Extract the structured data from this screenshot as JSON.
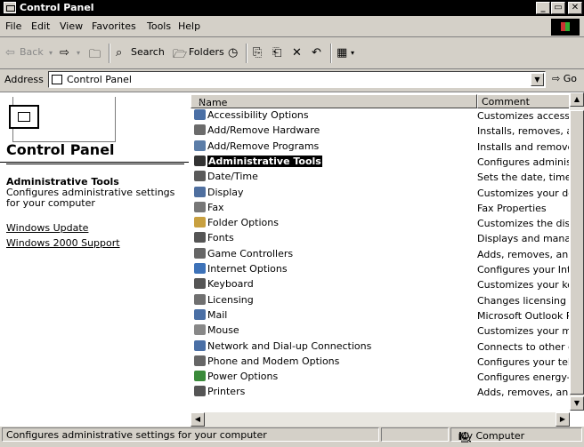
{
  "window": {
    "title": "Control Panel"
  },
  "title_buttons": {
    "minimize": "_",
    "maximize": "▭",
    "close": "✕"
  },
  "menu": [
    "File",
    "Edit",
    "View",
    "Favorites",
    "Tools",
    "Help"
  ],
  "toolbar": {
    "back": "Back",
    "search": "Search",
    "folders": "Folders"
  },
  "address": {
    "label": "Address",
    "value": "Control Panel",
    "go": "Go"
  },
  "left_pane": {
    "title": "Control Panel",
    "selected_title": "Administrative Tools",
    "selected_desc": "Configures administrative settings for your computer",
    "links": [
      "Windows Update",
      "Windows 2000 Support"
    ]
  },
  "columns": {
    "name": "Name",
    "comment": "Comment"
  },
  "items": [
    {
      "name": "Accessibility Options",
      "comment": "Customizes accessi...",
      "icon": "accessibility-icon",
      "color": "#4a6fa5"
    },
    {
      "name": "Add/Remove Hardware",
      "comment": "Installs, removes, a...",
      "icon": "hardware-icon",
      "color": "#6b6b6b"
    },
    {
      "name": "Add/Remove Programs",
      "comment": "Installs and remove...",
      "icon": "programs-icon",
      "color": "#5b7da8"
    },
    {
      "name": "Administrative Tools",
      "comment": "Configures administ...",
      "icon": "admin-tools-icon",
      "color": "#333333",
      "selected": true
    },
    {
      "name": "Date/Time",
      "comment": "Sets the date, time,...",
      "icon": "clock-icon",
      "color": "#5a5a5a"
    },
    {
      "name": "Display",
      "comment": "Customizes your de...",
      "icon": "display-icon",
      "color": "#4f6f9f"
    },
    {
      "name": "Fax",
      "comment": "Fax Properties",
      "icon": "fax-icon",
      "color": "#777777"
    },
    {
      "name": "Folder Options",
      "comment": "Customizes the disp...",
      "icon": "folder-icon",
      "color": "#c8a040"
    },
    {
      "name": "Fonts",
      "comment": "Displays and manag...",
      "icon": "fonts-icon",
      "color": "#555555"
    },
    {
      "name": "Game Controllers",
      "comment": "Adds, removes, an...",
      "icon": "joystick-icon",
      "color": "#666666"
    },
    {
      "name": "Internet Options",
      "comment": "Configures your Int...",
      "icon": "globe-icon",
      "color": "#3d72b8"
    },
    {
      "name": "Keyboard",
      "comment": "Customizes your ke...",
      "icon": "keyboard-icon",
      "color": "#555555"
    },
    {
      "name": "Licensing",
      "comment": "Changes licensing o...",
      "icon": "licensing-icon",
      "color": "#707070"
    },
    {
      "name": "Mail",
      "comment": "Microsoft Outlook P...",
      "icon": "mail-icon",
      "color": "#4a6fa5"
    },
    {
      "name": "Mouse",
      "comment": "Customizes your mo...",
      "icon": "mouse-icon",
      "color": "#888888"
    },
    {
      "name": "Network and Dial-up Connections",
      "comment": "Connects to other c...",
      "icon": "network-icon",
      "color": "#4a6fa5"
    },
    {
      "name": "Phone and Modem Options",
      "comment": "Configures your tel...",
      "icon": "phone-icon",
      "color": "#666666"
    },
    {
      "name": "Power Options",
      "comment": "Configures energy-...",
      "icon": "power-icon",
      "color": "#3a8a3a"
    },
    {
      "name": "Printers",
      "comment": "Adds, removes, an...",
      "icon": "printer-icon",
      "color": "#555555"
    }
  ],
  "status": {
    "text": "Configures administrative settings for your computer",
    "zone": "My Computer"
  }
}
